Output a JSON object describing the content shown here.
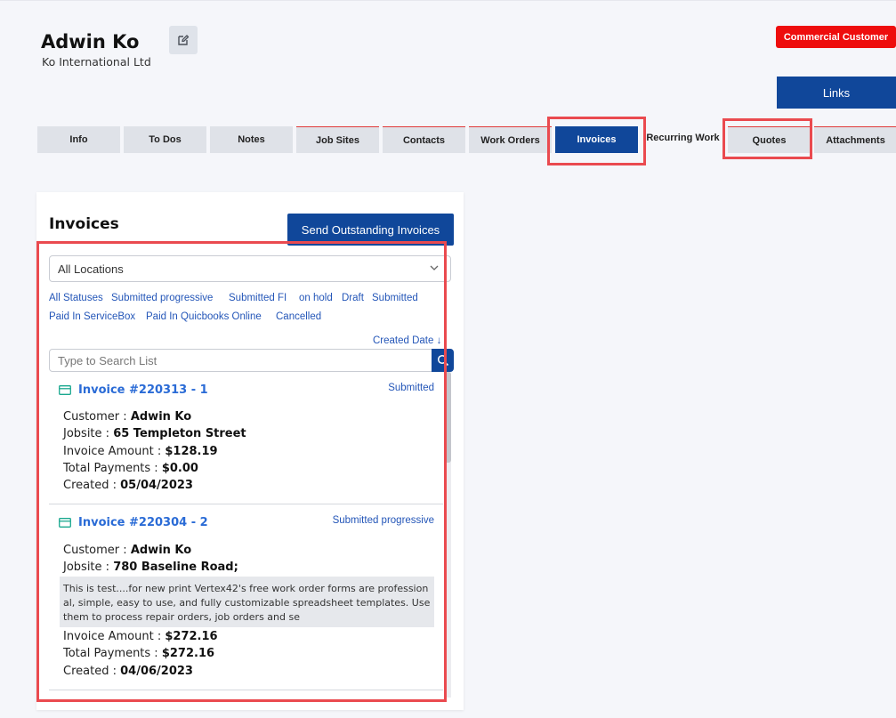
{
  "customer": {
    "name": "Adwin Ko",
    "company": "Ko International Ltd",
    "badge": "Commercial Customer",
    "links_label": "Links"
  },
  "icons": {
    "edit": "edit-icon",
    "card": "credit-card-icon",
    "search": "search-icon",
    "chevron": "chevron-down-icon"
  },
  "colors": {
    "primary": "#10479a",
    "badge": "#ee0d0d",
    "highlight": "#ea4a4f",
    "link": "#2456b8",
    "card_icon": "#1aa88f"
  },
  "tabs": [
    {
      "label": "Info"
    },
    {
      "label": "To Dos"
    },
    {
      "label": "Notes"
    },
    {
      "label": "Job Sites"
    },
    {
      "label": "Contacts"
    },
    {
      "label": "Work Orders"
    },
    {
      "label": "Invoices",
      "active": true
    },
    {
      "label": "Recurring Work"
    },
    {
      "label": "Quotes"
    },
    {
      "label": "Attachments"
    }
  ],
  "invoices_panel": {
    "title": "Invoices",
    "send_button": "Send Outstanding Invoices",
    "location_select": "All Locations",
    "statuses": [
      "All Statuses",
      "Submitted progressive",
      "Submitted FI",
      "on hold",
      "Draft",
      "Submitted",
      "Paid In ServiceBox",
      "Paid In Quicbooks Online",
      "Cancelled"
    ],
    "sort_label": "Created Date",
    "sort_arrow": "↓",
    "search_placeholder": "Type to Search List",
    "labels": {
      "customer": "Customer :",
      "jobsite": "Jobsite :",
      "amount": "Invoice Amount :",
      "payments": "Total Payments :",
      "created": "Created :"
    },
    "items": [
      {
        "title": "Invoice #220313 - 1",
        "status": "Submitted",
        "customer": "Adwin Ko",
        "jobsite": "65 Templeton Street",
        "amount": "$128.19",
        "payments": "$0.00",
        "created": "05/04/2023"
      },
      {
        "title": "Invoice #220304 - 2",
        "status": "Submitted progressive",
        "customer": "Adwin Ko",
        "jobsite": "780 Baseline Road;",
        "description": "This is test....for new print Vertex42's free work order forms are professional, simple, easy to use, and fully customizable spreadsheet templates. Use them to process repair orders, job orders and se",
        "amount": "$272.16",
        "payments": "$272.16",
        "created": "04/06/2023"
      }
    ]
  }
}
